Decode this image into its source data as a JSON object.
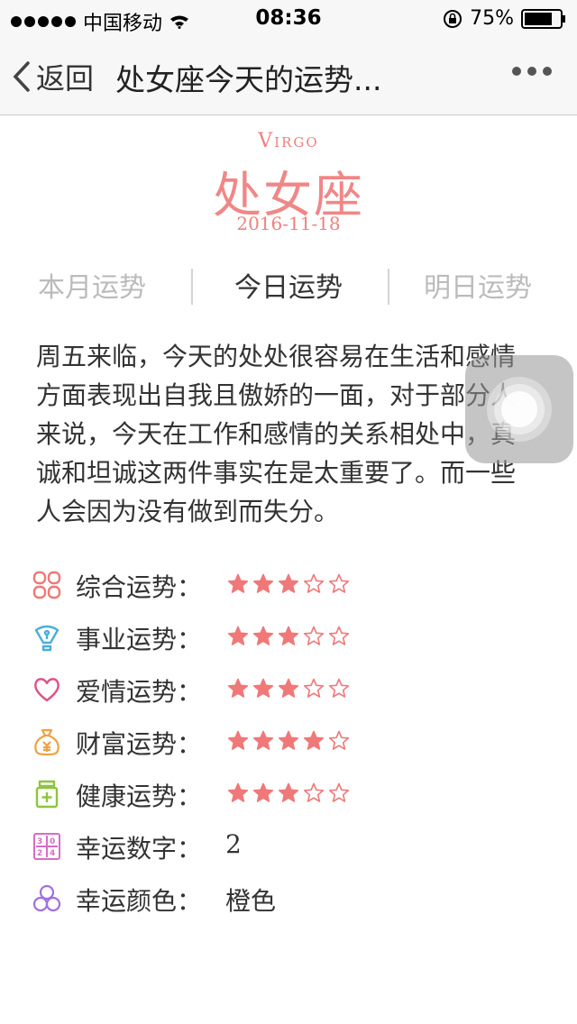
{
  "status_bar": {
    "carrier": "中国移动",
    "time": "08:36",
    "battery": "75%"
  },
  "nav": {
    "back_label": "返回",
    "title": "处女座今天的运势..."
  },
  "header": {
    "sign_en": "Virgo",
    "sign_cn": "处女座",
    "date": "2016-11-18"
  },
  "tabs": [
    {
      "label": "本月运势",
      "active": false
    },
    {
      "label": "今日运势",
      "active": true
    },
    {
      "label": "明日运势",
      "active": false
    }
  ],
  "description": "周五来临，今天的处处很容易在生活和感情方面表现出自我且傲娇的一面，对于部分人来说，今天在工作和感情的关系相处中，真诚和坦诚这两件事实在是太重要了。而一些人会因为没有做到而失分。",
  "fortunes": [
    {
      "label": "综合运势：",
      "rating": 3,
      "max": 5,
      "icon": "grid-icon",
      "color": "#f07878"
    },
    {
      "label": "事业运势：",
      "rating": 3,
      "max": 5,
      "icon": "pen-nib-icon",
      "color": "#4aaedb"
    },
    {
      "label": "爱情运势：",
      "rating": 3,
      "max": 5,
      "icon": "heart-icon",
      "color": "#e0508a"
    },
    {
      "label": "财富运势：",
      "rating": 4,
      "max": 5,
      "icon": "money-bag-icon",
      "color": "#f0a040"
    },
    {
      "label": "健康运势：",
      "rating": 3,
      "max": 5,
      "icon": "medicine-bottle-icon",
      "color": "#8cc63e"
    }
  ],
  "lucky": {
    "number_label": "幸运数字：",
    "number": "2",
    "number_icon": "calendar-numbers-icon",
    "number_icon_color": "#d66cc8",
    "color_label": "幸运颜色：",
    "color": "橙色",
    "color_icon": "three-circles-icon",
    "color_icon_color": "#a070e0"
  },
  "colors": {
    "accent": "#f08080",
    "star": "#f07878"
  }
}
